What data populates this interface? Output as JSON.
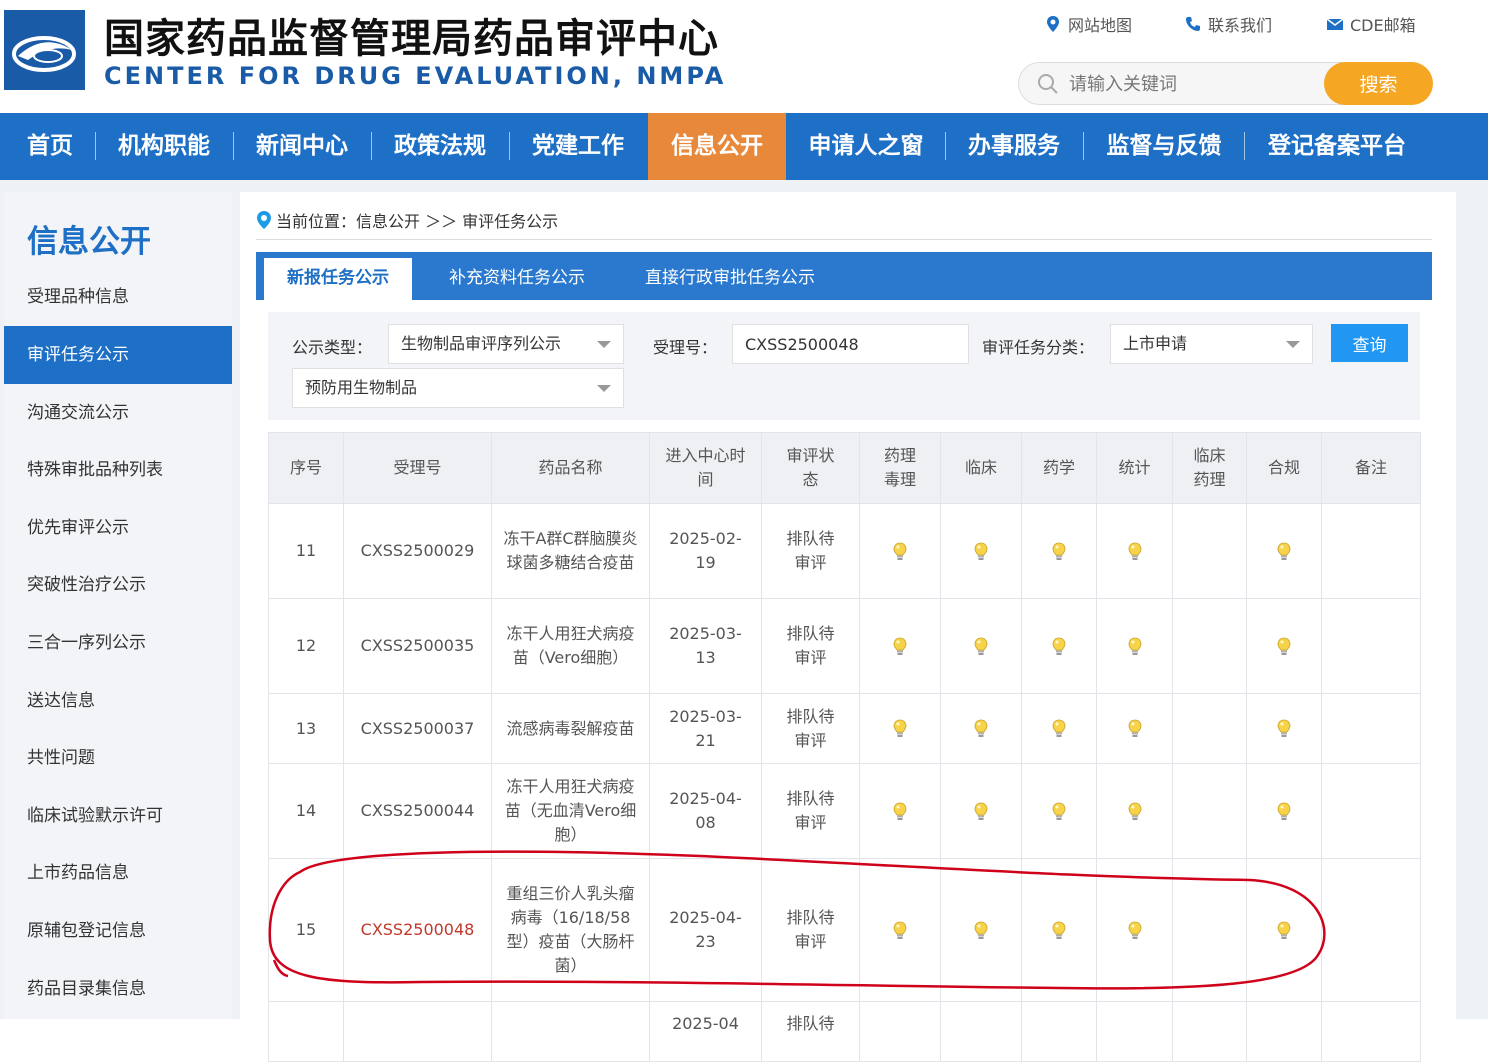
{
  "header": {
    "title_cn": "国家药品监督管理局药品审评中心",
    "title_en": "CENTER FOR DRUG EVALUATION, NMPA",
    "links": [
      {
        "label": "网站地图",
        "icon": "map-pin-icon"
      },
      {
        "label": "联系我们",
        "icon": "phone-icon"
      },
      {
        "label": "CDE邮箱",
        "icon": "mail-icon"
      }
    ],
    "search_placeholder": "请输入关键词",
    "search_button": "搜索"
  },
  "nav": {
    "items": [
      "首页",
      "机构职能",
      "新闻中心",
      "政策法规",
      "党建工作",
      "信息公开",
      "申请人之窗",
      "办事服务",
      "监督与反馈",
      "登记备案平台"
    ],
    "active": "信息公开"
  },
  "sidebar": {
    "title": "信息公开",
    "items": [
      "受理品种信息",
      "审评任务公示",
      "沟通交流公示",
      "特殊审批品种列表",
      "优先审评公示",
      "突破性治疗公示",
      "三合一序列公示",
      "送达信息",
      "共性问题",
      "临床试验默示许可",
      "上市药品信息",
      "原辅包登记信息",
      "药品目录集信息"
    ],
    "active": "审评任务公示"
  },
  "breadcrumb": {
    "label": "当前位置：信息公开 ＞＞ 审评任务公示"
  },
  "tabs": [
    "新报任务公示",
    "补充资料任务公示",
    "直接行政审批任务公示"
  ],
  "filters": {
    "type_label": "公示类型：",
    "type_value": "生物制品审评序列公示",
    "accept_label": "受理号：",
    "accept_value": "CXSS2500048",
    "category_label": "审评任务分类：",
    "category_value": "上市申请",
    "subtype_value": "预防用生物制品",
    "query_button": "查询"
  },
  "table": {
    "headers": [
      "序号",
      "受理号",
      "药品名称",
      "进入中心时间",
      "审评状态",
      "药理毒理",
      "临床",
      "药学",
      "统计",
      "临床药理",
      "合规",
      "备注"
    ],
    "rows": [
      {
        "no": "11",
        "id": "CXSS2500029",
        "name": "冻干A群C群脑膜炎球菌多糖结合疫苗",
        "date": "2025-02-19",
        "status": "排队待审评"
      },
      {
        "no": "12",
        "id": "CXSS2500035",
        "name": "冻干人用狂犬病疫苗（Vero细胞）",
        "date": "2025-03-13",
        "status": "排队待审评"
      },
      {
        "no": "13",
        "id": "CXSS2500037",
        "name": "流感病毒裂解疫苗",
        "date": "2025-03-21",
        "status": "排队待审评"
      },
      {
        "no": "14",
        "id": "CXSS2500044",
        "name": "冻干人用狂犬病疫苗（无血清Vero细胞）",
        "date": "2025-04-08",
        "status": "排队待审评"
      },
      {
        "no": "15",
        "id": "CXSS2500048",
        "name": "重组三价人乳头瘤病毒（16/18/58型）疫苗（大肠杆菌）",
        "date": "2025-04-23",
        "status": "排队待审评"
      }
    ],
    "partial_row": {
      "date": "2025-04",
      "status": "排队待"
    }
  },
  "colors": {
    "brand_blue": "#1e6fc6",
    "nav_active": "#e8883a",
    "search_button": "#f5a623",
    "highlight_text": "#c0392b",
    "annotation": "#d0021b"
  }
}
